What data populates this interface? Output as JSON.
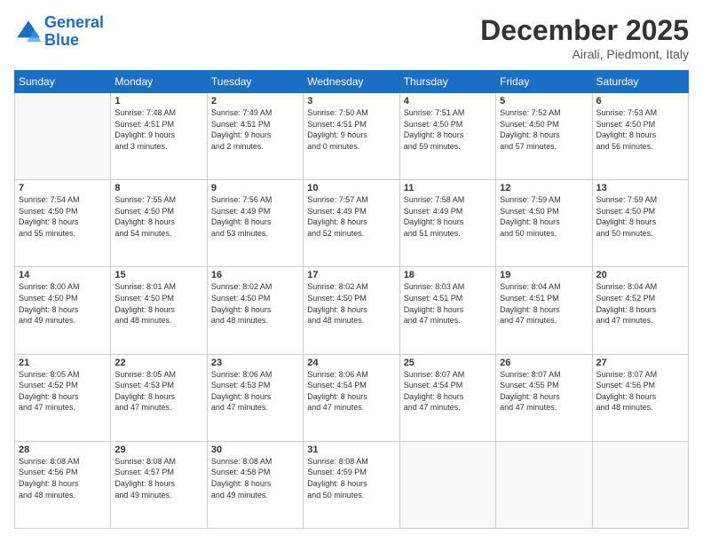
{
  "header": {
    "logo_line1": "General",
    "logo_line2": "Blue",
    "month": "December 2025",
    "location": "Airali, Piedmont, Italy"
  },
  "days_of_week": [
    "Sunday",
    "Monday",
    "Tuesday",
    "Wednesday",
    "Thursday",
    "Friday",
    "Saturday"
  ],
  "weeks": [
    [
      {
        "day": "",
        "info": ""
      },
      {
        "day": "1",
        "info": "Sunrise: 7:48 AM\nSunset: 4:51 PM\nDaylight: 9 hours\nand 3 minutes."
      },
      {
        "day": "2",
        "info": "Sunrise: 7:49 AM\nSunset: 4:51 PM\nDaylight: 9 hours\nand 2 minutes."
      },
      {
        "day": "3",
        "info": "Sunrise: 7:50 AM\nSunset: 4:51 PM\nDaylight: 9 hours\nand 0 minutes."
      },
      {
        "day": "4",
        "info": "Sunrise: 7:51 AM\nSunset: 4:50 PM\nDaylight: 8 hours\nand 59 minutes."
      },
      {
        "day": "5",
        "info": "Sunrise: 7:52 AM\nSunset: 4:50 PM\nDaylight: 8 hours\nand 57 minutes."
      },
      {
        "day": "6",
        "info": "Sunrise: 7:53 AM\nSunset: 4:50 PM\nDaylight: 8 hours\nand 56 minutes."
      }
    ],
    [
      {
        "day": "7",
        "info": "Sunrise: 7:54 AM\nSunset: 4:50 PM\nDaylight: 8 hours\nand 55 minutes."
      },
      {
        "day": "8",
        "info": "Sunrise: 7:55 AM\nSunset: 4:50 PM\nDaylight: 8 hours\nand 54 minutes."
      },
      {
        "day": "9",
        "info": "Sunrise: 7:56 AM\nSunset: 4:49 PM\nDaylight: 8 hours\nand 53 minutes."
      },
      {
        "day": "10",
        "info": "Sunrise: 7:57 AM\nSunset: 4:49 PM\nDaylight: 8 hours\nand 52 minutes."
      },
      {
        "day": "11",
        "info": "Sunrise: 7:58 AM\nSunset: 4:49 PM\nDaylight: 8 hours\nand 51 minutes."
      },
      {
        "day": "12",
        "info": "Sunrise: 7:59 AM\nSunset: 4:50 PM\nDaylight: 8 hours\nand 50 minutes."
      },
      {
        "day": "13",
        "info": "Sunrise: 7:59 AM\nSunset: 4:50 PM\nDaylight: 8 hours\nand 50 minutes."
      }
    ],
    [
      {
        "day": "14",
        "info": "Sunrise: 8:00 AM\nSunset: 4:50 PM\nDaylight: 8 hours\nand 49 minutes."
      },
      {
        "day": "15",
        "info": "Sunrise: 8:01 AM\nSunset: 4:50 PM\nDaylight: 8 hours\nand 48 minutes."
      },
      {
        "day": "16",
        "info": "Sunrise: 8:02 AM\nSunset: 4:50 PM\nDaylight: 8 hours\nand 48 minutes."
      },
      {
        "day": "17",
        "info": "Sunrise: 8:02 AM\nSunset: 4:50 PM\nDaylight: 8 hours\nand 48 minutes."
      },
      {
        "day": "18",
        "info": "Sunrise: 8:03 AM\nSunset: 4:51 PM\nDaylight: 8 hours\nand 47 minutes."
      },
      {
        "day": "19",
        "info": "Sunrise: 8:04 AM\nSunset: 4:51 PM\nDaylight: 8 hours\nand 47 minutes."
      },
      {
        "day": "20",
        "info": "Sunrise: 8:04 AM\nSunset: 4:52 PM\nDaylight: 8 hours\nand 47 minutes."
      }
    ],
    [
      {
        "day": "21",
        "info": "Sunrise: 8:05 AM\nSunset: 4:52 PM\nDaylight: 8 hours\nand 47 minutes."
      },
      {
        "day": "22",
        "info": "Sunrise: 8:05 AM\nSunset: 4:53 PM\nDaylight: 8 hours\nand 47 minutes."
      },
      {
        "day": "23",
        "info": "Sunrise: 8:06 AM\nSunset: 4:53 PM\nDaylight: 8 hours\nand 47 minutes."
      },
      {
        "day": "24",
        "info": "Sunrise: 8:06 AM\nSunset: 4:54 PM\nDaylight: 8 hours\nand 47 minutes."
      },
      {
        "day": "25",
        "info": "Sunrise: 8:07 AM\nSunset: 4:54 PM\nDaylight: 8 hours\nand 47 minutes."
      },
      {
        "day": "26",
        "info": "Sunrise: 8:07 AM\nSunset: 4:55 PM\nDaylight: 8 hours\nand 47 minutes."
      },
      {
        "day": "27",
        "info": "Sunrise: 8:07 AM\nSunset: 4:56 PM\nDaylight: 8 hours\nand 48 minutes."
      }
    ],
    [
      {
        "day": "28",
        "info": "Sunrise: 8:08 AM\nSunset: 4:56 PM\nDaylight: 8 hours\nand 48 minutes."
      },
      {
        "day": "29",
        "info": "Sunrise: 8:08 AM\nSunset: 4:57 PM\nDaylight: 8 hours\nand 49 minutes."
      },
      {
        "day": "30",
        "info": "Sunrise: 8:08 AM\nSunset: 4:58 PM\nDaylight: 8 hours\nand 49 minutes."
      },
      {
        "day": "31",
        "info": "Sunrise: 8:08 AM\nSunset: 4:59 PM\nDaylight: 8 hours\nand 50 minutes."
      },
      {
        "day": "",
        "info": ""
      },
      {
        "day": "",
        "info": ""
      },
      {
        "day": "",
        "info": ""
      }
    ]
  ]
}
